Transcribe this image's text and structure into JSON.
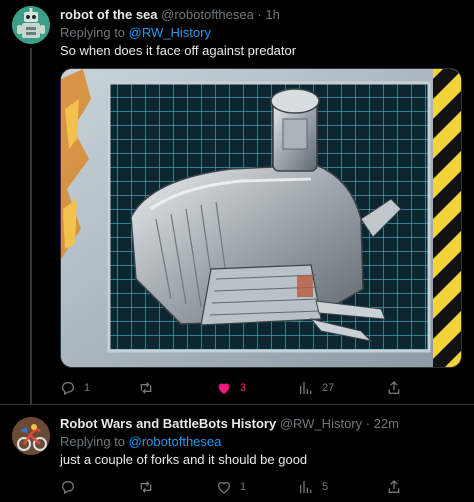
{
  "tweets": [
    {
      "display_name": "robot of the sea",
      "handle": "@robotofthesea",
      "separator": " · ",
      "time": "1h",
      "replying_to_prefix": "Replying to ",
      "replying_to": "@RW_History",
      "text": "So when does it face off against predator",
      "counts": {
        "reply": "1",
        "retweet": "",
        "like": "3",
        "views": "27"
      },
      "liked": true
    },
    {
      "display_name": "Robot Wars and BattleBots History",
      "handle": "@RW_History",
      "separator": " · ",
      "time": "22m",
      "replying_to_prefix": "Replying to ",
      "replying_to": "@robotofthesea",
      "text": "just a couple of forks and it should be good",
      "counts": {
        "reply": "",
        "retweet": "",
        "like": "1",
        "views": "5"
      },
      "liked": false
    }
  ],
  "icons": {
    "reply": "reply-icon",
    "retweet": "retweet-icon",
    "like": "heart-icon",
    "views": "views-icon",
    "share": "share-icon"
  },
  "colors": {
    "like_active": "#f91880",
    "link": "#1d9bf0",
    "muted": "#71767b"
  }
}
